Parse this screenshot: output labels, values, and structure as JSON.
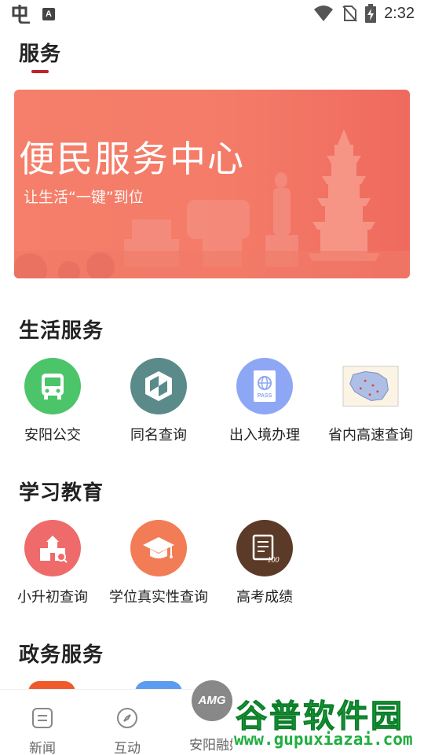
{
  "status_bar": {
    "time": "2:32",
    "app_icon": "chinese-glyph-icon",
    "notification_icon": "a-box-icon",
    "notification_letter": "A",
    "icons": [
      "wifi-icon",
      "no-sim-icon",
      "battery-charging-icon"
    ]
  },
  "header": {
    "title": "服务"
  },
  "banner": {
    "title": "便民服务中心",
    "subtitle": "让生活“一键”到位"
  },
  "sections": [
    {
      "title": "生活服务",
      "items": [
        {
          "label": "安阳公交",
          "icon": "bus-icon",
          "color": "#4cc46a"
        },
        {
          "label": "同名查询",
          "icon": "shield-icon",
          "color": "#5a8a8a"
        },
        {
          "label": "出入境办理",
          "icon": "passport-icon",
          "color": "#8ea7f5"
        },
        {
          "label": "省内高速查询",
          "icon": "map-icon",
          "color": "#ffffff"
        }
      ]
    },
    {
      "title": "学习教育",
      "items": [
        {
          "label": "小升初查询",
          "icon": "school-icon",
          "color": "#ef6b6b"
        },
        {
          "label": "学位真实性查询",
          "icon": "graduation-cap-icon",
          "color": "#f27c55"
        },
        {
          "label": "高考成绩",
          "icon": "score-paper-icon",
          "color": "#5c3a28"
        }
      ]
    },
    {
      "title": "政务服务",
      "items": []
    }
  ],
  "bottom_nav": {
    "items": [
      {
        "label": "新闻",
        "icon": "news-icon"
      },
      {
        "label": "互动",
        "icon": "compass-icon"
      },
      {
        "label": "安阳融媒",
        "icon": "amg-logo-icon"
      }
    ],
    "center_logo": "AMG"
  },
  "watermark": {
    "top": "谷普软件园",
    "bottom": "www.gupuxiazai.com"
  }
}
